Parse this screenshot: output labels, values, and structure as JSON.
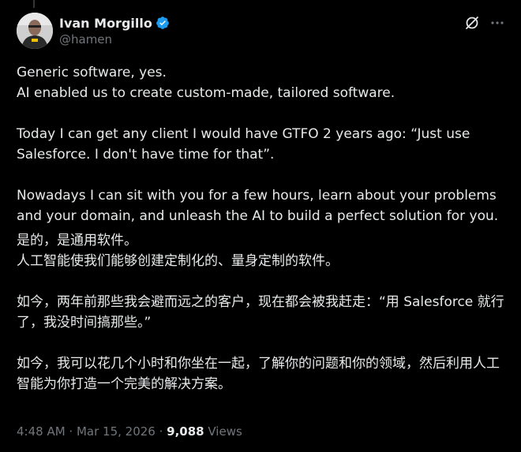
{
  "author": {
    "display_name": "Ivan Morgillo",
    "handle": "@hamen",
    "verified": true,
    "verified_color": "#1d9bf0"
  },
  "icons": {
    "grok": "grok-icon",
    "more": "more-icon"
  },
  "post": {
    "text_en": "Generic software, yes.\nAI enabled us to create custom-made, tailored software.\n\nToday I can get any client I would have GTFO 2 years ago: “Just use Salesforce. I don't have time for that”.\n\nNowadays I can sit with you for a few hours, learn about your problems and your domain, and unleash the AI to build a perfect solution for you.",
    "text_zh": "是的，是通用软件。\n人工智能使我们能够创建定制化的、量身定制的软件。\n\n如今，两年前那些我会避而远之的客户，现在都会被我赶走：“用 Salesforce 就行了，我没时间搞那些。”\n\n如今，我可以花几个小时和你坐在一起，了解你的问题和你的领域，然后利用人工智能为你打造一个完美的解决方案。"
  },
  "meta": {
    "time": "4:48 AM",
    "separator": " · ",
    "date": "Mar 15, 2026",
    "views_count": "9,088",
    "views_label": " Views"
  },
  "colors": {
    "background": "#000000",
    "text": "#e7e9ea",
    "muted": "#71767b"
  }
}
